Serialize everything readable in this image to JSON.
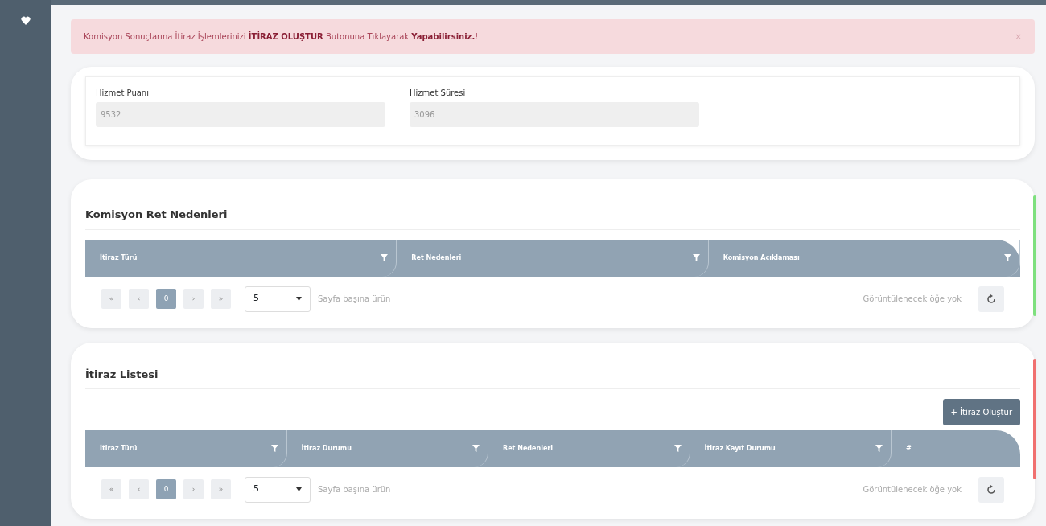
{
  "alert": {
    "text": "Komisyon Sonuçlarına İtiraz İşlemlerinizi **İTİRAZ OLUŞTUR** Butonuna Tıklayarak **Yapabilirsiniz.**!",
    "close": "×"
  },
  "service": {
    "fields": [
      {
        "label": "Hizmet Puanı",
        "value": "9532"
      },
      {
        "label": "Hizmet Süresi",
        "value": "3096"
      }
    ]
  },
  "grids": [
    {
      "title": "Komisyon Ret Nedenleri",
      "columns": [
        {
          "label": "İtiraz Türü",
          "filter": true
        },
        {
          "label": "Ret Nedenleri",
          "filter": true
        },
        {
          "label": "Komisyon Açıklaması",
          "filter": true
        }
      ],
      "pager": {
        "buttons": [
          {
            "label": "«",
            "selected": false
          },
          {
            "label": "‹",
            "selected": false
          },
          {
            "label": "0",
            "selected": true
          },
          {
            "label": "›",
            "selected": false
          },
          {
            "label": "»",
            "selected": false
          }
        ],
        "page_size": "5",
        "per_page": "Sayfa başına ürün",
        "empty": "Görüntülenecek öğe yok"
      },
      "color": "#7ee07e"
    },
    {
      "title": "İtiraz Listesi",
      "button": "+ İtiraz Oluştur",
      "columns": [
        {
          "label": "İtiraz Türü",
          "filter": true
        },
        {
          "label": "İtiraz Durumu",
          "filter": true
        },
        {
          "label": "Ret Nedenleri",
          "filter": true
        },
        {
          "label": "İtiraz Kayıt Durumu",
          "filter": true
        },
        {
          "label": "#",
          "filter": false
        }
      ],
      "pager": {
        "buttons": [
          {
            "label": "«",
            "selected": false
          },
          {
            "label": "‹",
            "selected": false
          },
          {
            "label": "0",
            "selected": true
          },
          {
            "label": "›",
            "selected": false
          },
          {
            "label": "»",
            "selected": false
          }
        ],
        "page_size": "5",
        "per_page": "Sayfa başına ürün",
        "empty": "Görüntülenecek öğe yok"
      },
      "color": "#f07070"
    }
  ]
}
